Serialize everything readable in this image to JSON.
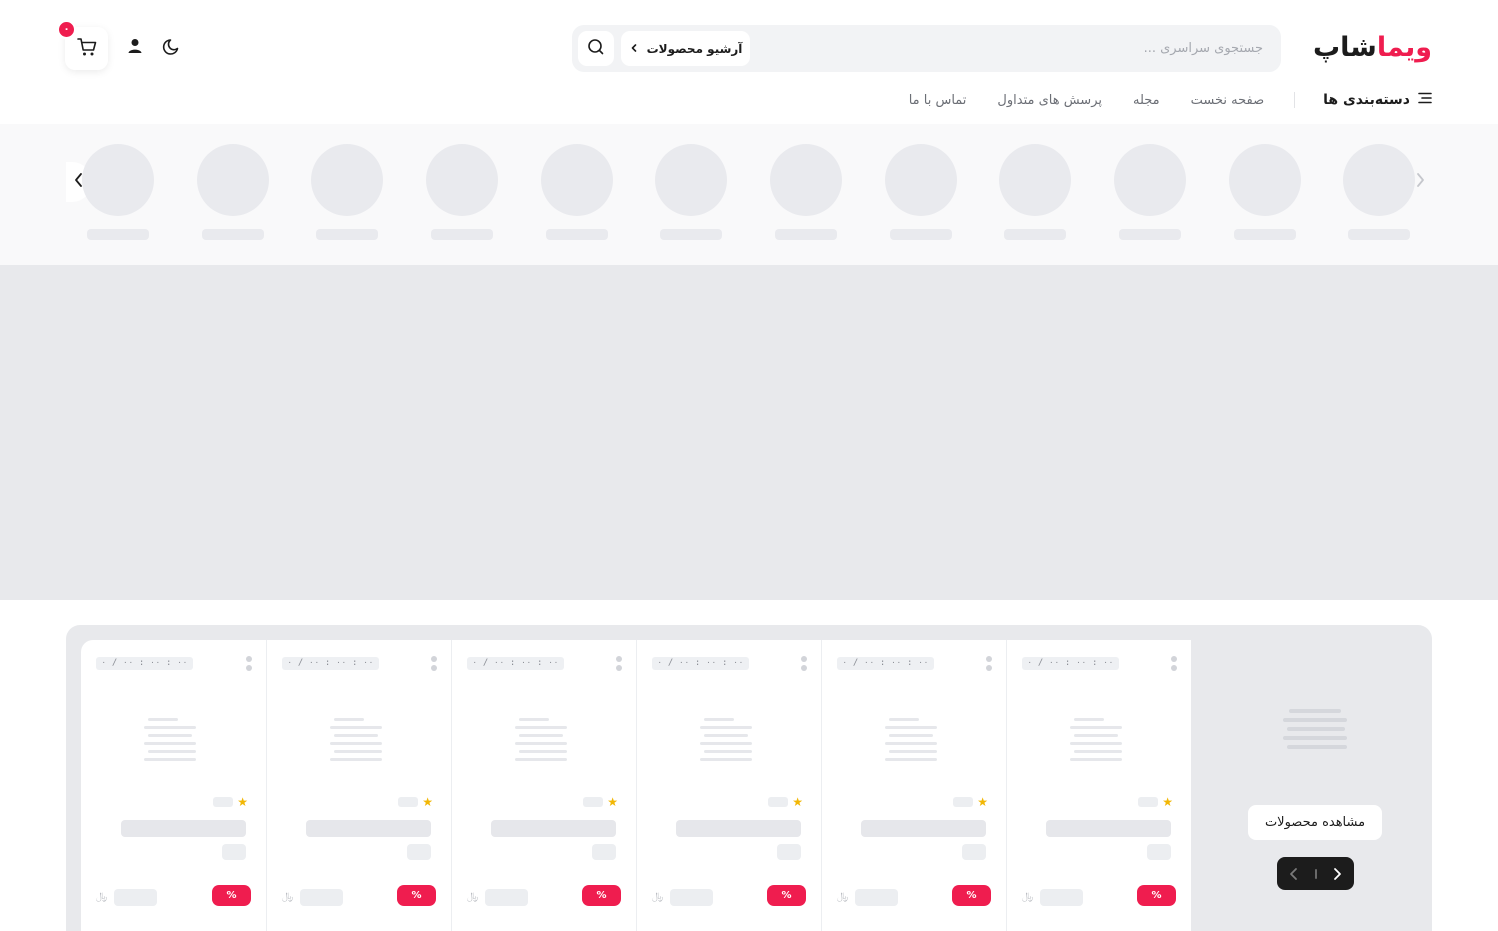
{
  "header": {
    "logo_part1": "ویما",
    "logo_part2": "شاپ",
    "search_placeholder": "جستجوی سراسری ...",
    "archive_label": "آرشیو محصولات",
    "cart_count": "۰"
  },
  "nav": {
    "categories_label": "دسته‌بندی ها",
    "links": [
      "صفحه نخست",
      "مجله",
      "پرسش های متداول",
      "تماس با ما"
    ]
  },
  "offers": {
    "view_products_label": "مشاهده محصولات",
    "cards": [
      {
        "timer": "۰ / ۰۰ : ۰۰ : ۰۰",
        "discount": "%",
        "currency": "﷼"
      },
      {
        "timer": "۰ / ۰۰ : ۰۰ : ۰۰",
        "discount": "%",
        "currency": "﷼"
      },
      {
        "timer": "۰ / ۰۰ : ۰۰ : ۰۰",
        "discount": "%",
        "currency": "﷼"
      },
      {
        "timer": "۰ / ۰۰ : ۰۰ : ۰۰",
        "discount": "%",
        "currency": "﷼"
      },
      {
        "timer": "۰ / ۰۰ : ۰۰ : ۰۰",
        "discount": "%",
        "currency": "﷼"
      },
      {
        "timer": "۰ / ۰۰ : ۰۰ : ۰۰",
        "discount": "%",
        "currency": "﷼"
      }
    ]
  },
  "colors": {
    "accent": "#ef1d4f",
    "dark": "#1c1c1c",
    "placeholder": "#e8e9ec",
    "star": "#f2b705"
  },
  "icons": {
    "search": "search-icon",
    "archive_chevron": "chevron-left-icon",
    "theme": "moon-icon",
    "user": "user-icon",
    "cart": "cart-icon",
    "categories": "menu-lines-icon",
    "story_prev": "chevron-left-icon",
    "story_next": "chevron-right-icon",
    "more": "vertical-dots-icon",
    "rating": "star-icon"
  }
}
